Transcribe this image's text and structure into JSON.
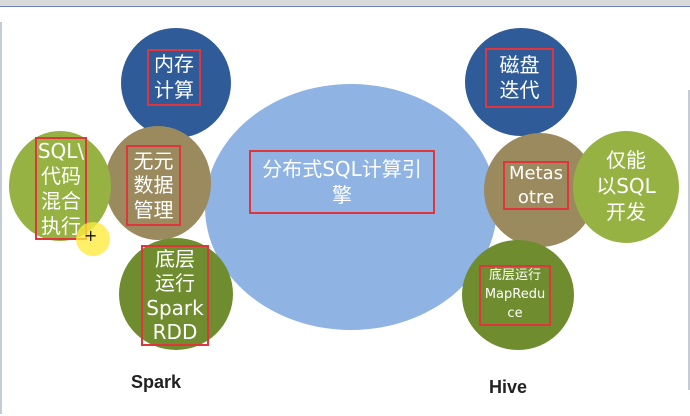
{
  "colors": {
    "dark_blue": "#2f5b98",
    "light_blue": "#8fb3e3",
    "olive": "#9b8a5e",
    "green": "#95b243",
    "dark_green": "#6f8d2e",
    "highlight_border": "#e0353d"
  },
  "center": {
    "text": "分布式SQL计算引\n擎"
  },
  "spark": {
    "label": "Spark",
    "memory": "内存\n计算",
    "metadata": "无元\n数据\n管理",
    "sql_mixed": "SQL\\\n代码\n混合\n执行",
    "bottom": "底层\n运行\nSpark\nRDD"
  },
  "hive": {
    "label": "Hive",
    "disk": "磁盘\n迭代",
    "metastore": "Metas\notre",
    "only_sql": "仅能\n以SQL\n开发",
    "bottom": "底层运行\nMapRedu\nce"
  },
  "cursor": {
    "icon": "crosshair-cursor-icon"
  }
}
